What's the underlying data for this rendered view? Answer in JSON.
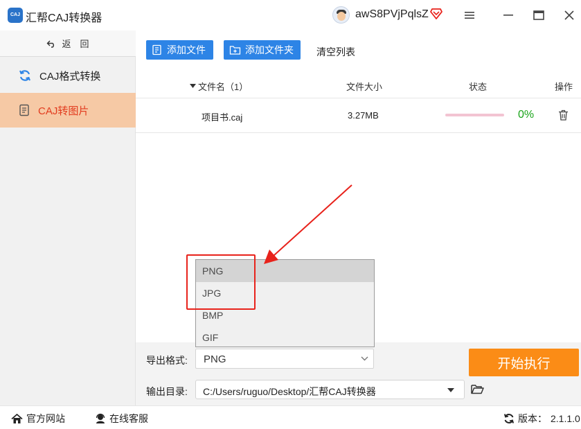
{
  "window": {
    "title": "汇帮CAJ转换器",
    "logo_text": "CAJ",
    "username": "awS8PVjPqlsZ",
    "menu_icon": "hamburger-icon",
    "maximize_icon": "maximize-icon",
    "close_icon": "close-icon"
  },
  "sidebar": {
    "back_label": "返　回",
    "items": [
      {
        "label": "CAJ格式转换",
        "icon": "refresh-icon",
        "active": false
      },
      {
        "label": "CAJ转图片",
        "icon": "document-icon",
        "active": true
      }
    ]
  },
  "toolbar": {
    "add_file": "添加文件",
    "add_folder": "添加文件夹",
    "clear_list": "清空列表"
  },
  "table": {
    "headers": {
      "name": "文件名（1）",
      "size": "文件大小",
      "status": "状态",
      "action": "操作"
    },
    "rows": [
      {
        "name": "项目书.caj",
        "size": "3.27MB",
        "progress": 0,
        "percent": "0%"
      }
    ]
  },
  "settings": {
    "format_label": "导出格式:",
    "format_value": "PNG",
    "format_options": [
      "PNG",
      "JPG",
      "BMP",
      "GIF"
    ],
    "output_label": "输出目录:",
    "output_path": "C:/Users/ruguo/Desktop/汇帮CAJ转换器",
    "start_button": "开始执行"
  },
  "footer": {
    "website": "官方网站",
    "support": "在线客服",
    "version_label": "版本：",
    "version": "2.1.1.0"
  },
  "colors": {
    "accent_blue": "#2d84e6",
    "active_bg": "#f6c9a5",
    "active_text": "#e23b1e",
    "start_button": "#fb8c16",
    "percent": "#18a318",
    "annotation": "#e8221b"
  }
}
